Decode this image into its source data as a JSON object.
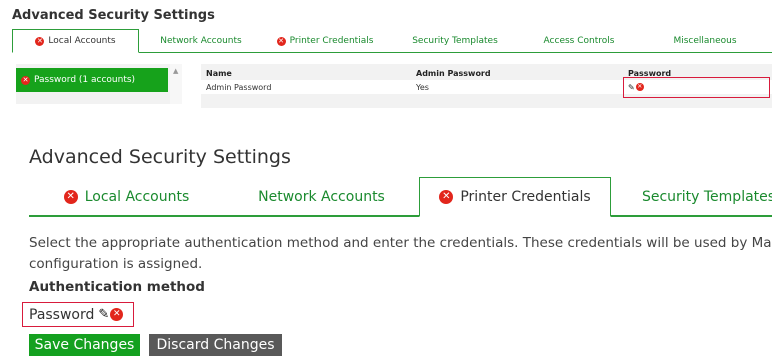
{
  "top": {
    "title": "Advanced Security Settings",
    "tabs": [
      {
        "label": "Local Accounts",
        "error": true,
        "active": true
      },
      {
        "label": "Network Accounts",
        "error": false,
        "active": false
      },
      {
        "label": "Printer Credentials",
        "error": true,
        "active": false
      },
      {
        "label": "Security Templates",
        "error": false,
        "active": false
      },
      {
        "label": "Access Controls",
        "error": false,
        "active": false
      },
      {
        "label": "Miscellaneous",
        "error": false,
        "active": false
      }
    ],
    "sidebar": {
      "items": [
        {
          "label": "Password (1 accounts)",
          "error": true,
          "selected": true
        }
      ]
    },
    "table": {
      "columns": [
        "Name",
        "Admin Password",
        "Password"
      ],
      "rows": [
        [
          "Admin Password",
          "Yes",
          ""
        ]
      ]
    }
  },
  "main": {
    "title": "Advanced Security Settings",
    "tabs": [
      {
        "label": "Local Accounts",
        "error": true,
        "active": false
      },
      {
        "label": "Network Accounts",
        "error": false,
        "active": false
      },
      {
        "label": "Printer Credentials",
        "error": true,
        "active": true
      },
      {
        "label": "Security Templates",
        "error": false,
        "active": false
      }
    ],
    "description_line1": "Select the appropriate authentication method and enter the credentials. These credentials will be used by Markvisi",
    "description_line2": "configuration is assigned.",
    "auth_label": "Authentication method",
    "auth_value": "Password",
    "save_label": "Save Changes",
    "discard_label": "Discard Changes"
  },
  "icons": {
    "error": "error-x-circle-icon",
    "edit": "pencil-icon"
  },
  "colors": {
    "accent": "#16a21b",
    "error": "#e2261c",
    "highlight": "#d81b3c",
    "discard": "#595959"
  }
}
